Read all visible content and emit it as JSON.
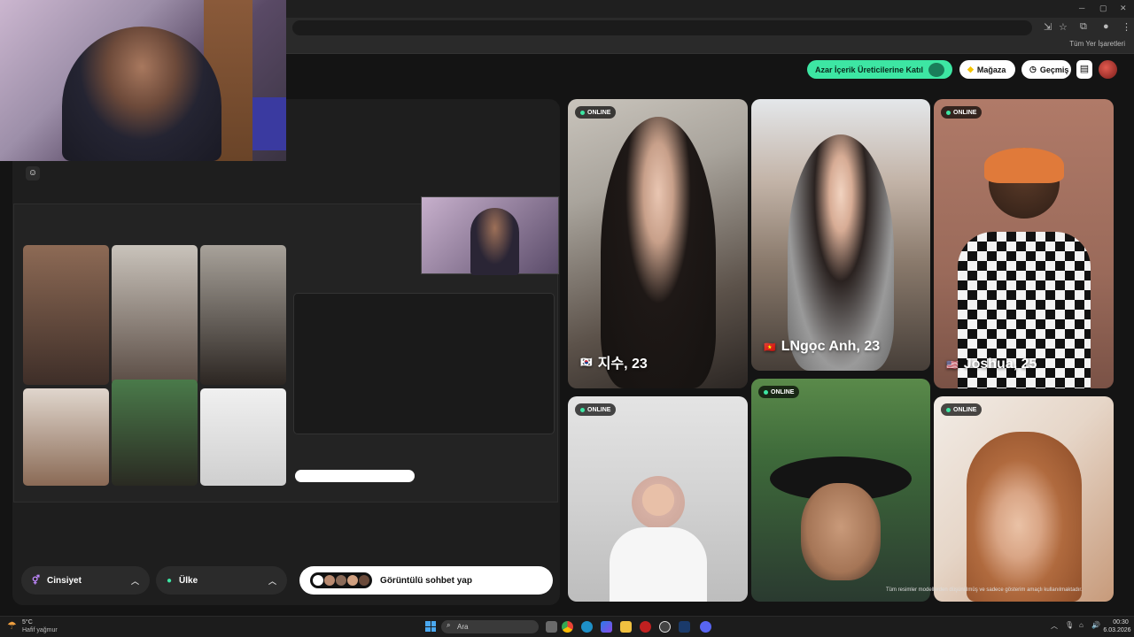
{
  "browser": {
    "bookmarks_label": "Tüm Yer İşaretleri"
  },
  "header": {
    "creator_button": "Azar İçerik Üreticilerine Katıl",
    "store_button": "Mağaza",
    "history_button": "Geçmiş"
  },
  "controls": {
    "gender_label": "Cinsiyet",
    "country_label": "Ülke",
    "start_button": "Görüntülü sohbet yap"
  },
  "cards": [
    {
      "status": "ONLINE",
      "name": "지수, 23",
      "flag": "🇰🇷"
    },
    {
      "status": "",
      "name": "LNgọc Anh, 23",
      "flag": "🇻🇳"
    },
    {
      "status": "ONLINE",
      "name": "Joshua, 25",
      "flag": "🇺🇸"
    },
    {
      "status": "ONLINE",
      "name": "",
      "flag": ""
    },
    {
      "status": "ONLINE",
      "name": "",
      "flag": ""
    },
    {
      "status": "ONLINE",
      "name": "",
      "flag": ""
    }
  ],
  "disclaimer": "Tüm resimler modellerden düşünülmüş ve sadece gösterim amaçlı kullanılmaktadır.",
  "taskbar": {
    "weather_temp": "5°C",
    "weather_desc": "Hafif yağmur",
    "search_placeholder": "Ara",
    "time": "00:30",
    "date": "6.03.2026"
  },
  "colors": {
    "accent": "#3de6a3",
    "page_bg": "#141414",
    "panel_bg": "#1e1e1e"
  }
}
